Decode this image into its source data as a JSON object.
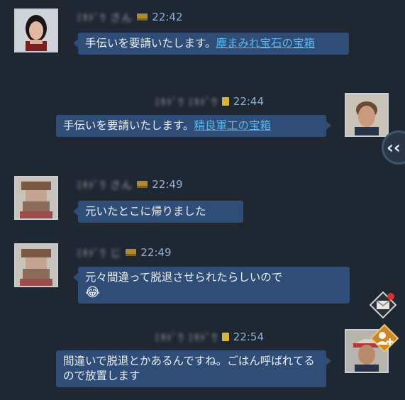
{
  "messages": [
    {
      "name": "ﾐｷﾄﾞｳ さん",
      "time": "22:42",
      "text": "手伝いを要請いたします。",
      "link": "塵まみれ宝石の宝箱"
    },
    {
      "name": "ﾐｷﾄﾞｳ ﾐｷﾄﾞｳ",
      "time": "22:44",
      "text": "手伝いを要請いたします。",
      "link": "精良軍工の宝箱"
    },
    {
      "name": "ﾐｷﾄﾞｳ さん",
      "time": "22:49",
      "text": "元いたとこに帰りました"
    },
    {
      "name": "ﾐｷﾄﾞｳ じ",
      "time": "22:49",
      "text": "元々間違って脱退させられたらしいので",
      "emoji": "😂"
    },
    {
      "name": "ﾐｷﾄﾞｳ ﾐｷﾄﾞｳ",
      "time": "22:54",
      "text": "間違いで脱退とかあるんですね。ごはん呼ばれてるので放置します"
    }
  ],
  "side": {
    "collapse_glyph": "‹‹",
    "mail_icon": "mail-icon",
    "add_friend_icon": "add-friend-icon"
  },
  "colors": {
    "background": "#1f2733",
    "bubble": "#2f4d76",
    "link": "#5fb6ea",
    "time": "#8fb0d6"
  }
}
